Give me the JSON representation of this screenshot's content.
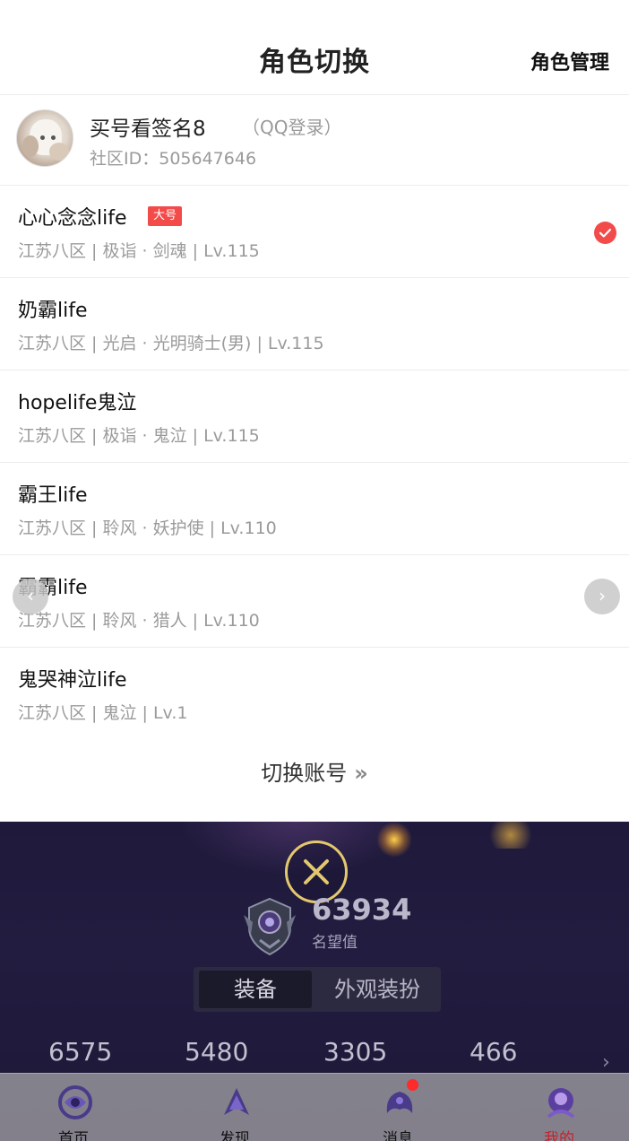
{
  "header": {
    "title": "角色切换",
    "action": "角色管理"
  },
  "account": {
    "name": "买号看签名8",
    "login": "（QQ登录）",
    "community_id": "社区ID：505647646"
  },
  "roles": [
    {
      "name": "心心念念life",
      "badge": "大号",
      "info": "江苏八区 | 极诣 · 剑魂 | Lv.115",
      "selected": true
    },
    {
      "name": "奶霸life",
      "info": "江苏八区 | 光启 · 光明骑士(男) | Lv.115"
    },
    {
      "name": "hopelife鬼泣",
      "info": "江苏八区 | 极诣 · 鬼泣 | Lv.115"
    },
    {
      "name": "霸王life",
      "info": "江苏八区 | 聆风 · 妖护使 | Lv.110"
    },
    {
      "name": "霸霸life",
      "info": "江苏八区 | 聆风 · 猎人 | Lv.110"
    },
    {
      "name": "鬼哭神泣life",
      "info": "江苏八区 | 鬼泣 | Lv.1"
    }
  ],
  "switch_account": {
    "label": "切换账号",
    "chevron": "»"
  },
  "background": {
    "fame_value": "63934",
    "fame_label": "名望值",
    "tabs": [
      "装备",
      "外观装扮"
    ],
    "stats": [
      "6575",
      "5480",
      "3305",
      "466"
    ]
  },
  "tabbar": {
    "items": [
      {
        "label": "首页",
        "icon": "home-icon"
      },
      {
        "label": "发现",
        "icon": "discover-icon"
      },
      {
        "label": "消息",
        "icon": "message-icon",
        "notification": true
      },
      {
        "label": "我的",
        "icon": "profile-icon",
        "active": true
      }
    ]
  },
  "colors": {
    "accent_red": "#f34a4a",
    "close_gold": "#e4c86f",
    "dark_bg": "#1f1a3b"
  }
}
